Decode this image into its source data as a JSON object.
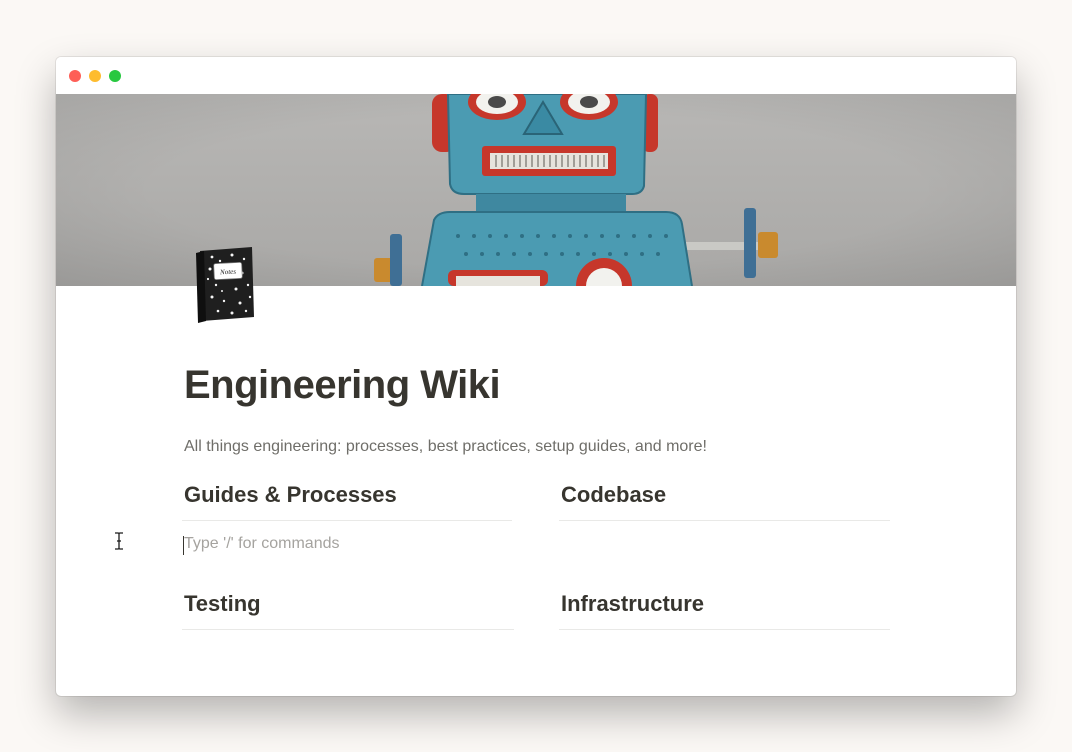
{
  "window": {
    "buttons": [
      "close",
      "minimize",
      "maximize"
    ]
  },
  "page": {
    "icon": "composition-notebook-icon",
    "icon_label": "Notes",
    "cover": "tin-robot-cover-image",
    "title": "Engineering Wiki",
    "description": "All things engineering: processes, best practices, setup guides, and more!",
    "sections": [
      {
        "heading": "Guides & Processes"
      },
      {
        "heading": "Codebase"
      },
      {
        "heading": "Testing"
      },
      {
        "heading": "Infrastructure"
      }
    ],
    "editor": {
      "placeholder": "Type '/' for commands"
    }
  },
  "colors": {
    "text": "#37352f",
    "muted": "#6f6e69",
    "placeholder": "#a5a39f",
    "divider": "#e9e9e7",
    "close": "#fe5f57",
    "minimize": "#febc2e",
    "maximize": "#28c840"
  }
}
